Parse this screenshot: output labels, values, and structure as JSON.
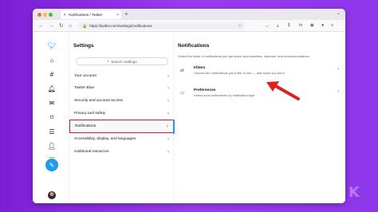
{
  "browser": {
    "tab_title": "Notifications / Twitter",
    "tab_close": "×",
    "new_tab": "+",
    "tab_overflow": "⌄",
    "url": "https://twitter.com/settings/notifications"
  },
  "settings": {
    "title": "Settings",
    "search_placeholder": "Search Settings",
    "items": [
      {
        "label": "Your account"
      },
      {
        "label": "Twitter Blue"
      },
      {
        "label": "Security and account access"
      },
      {
        "label": "Privacy and safety"
      },
      {
        "label": "Notifications"
      },
      {
        "label": "Accessibility, display, and languages"
      },
      {
        "label": "Additional resources"
      }
    ]
  },
  "notifications": {
    "title": "Notifications",
    "description": "Select the kinds of notifications you get about your activities, interests, and recommendations.",
    "rows": [
      {
        "title": "Filters",
        "subtitle": "Choose the notifications you’d like to see — and those you don’t."
      },
      {
        "title": "Preferences",
        "subtitle": "Select your preferences by notification type."
      }
    ]
  },
  "colors": {
    "accent": "#1d9bf0",
    "highlight_border": "#d61b24",
    "annotation_arrow": "#e02020",
    "background": "#8a2be2"
  },
  "icons": {
    "twitter-logo": "bird-icon",
    "filters": "sliders-icon",
    "preferences": "video-icon"
  }
}
